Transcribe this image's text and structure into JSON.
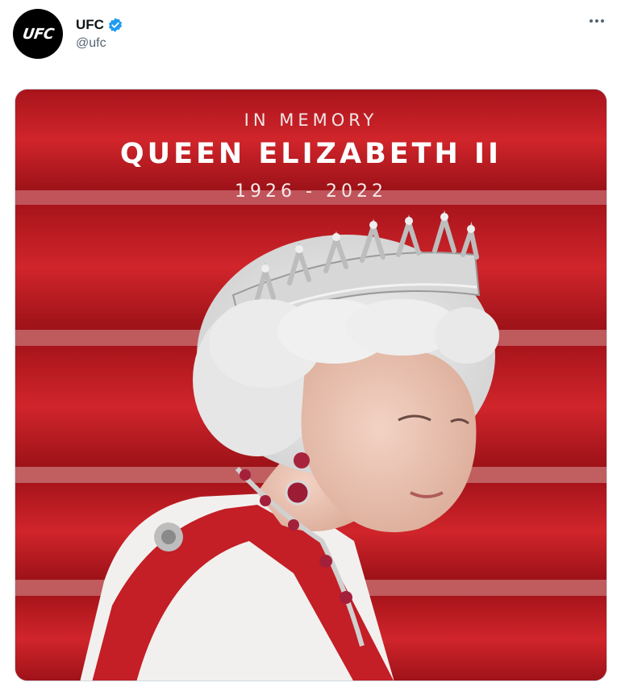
{
  "tweet": {
    "display_name": "UFC",
    "handle": "@ufc",
    "avatar_text": "UFC",
    "verified": true,
    "more_icon": "more-horizontal-icon"
  },
  "media": {
    "line1": "IN MEMORY",
    "line2": "QUEEN ELIZABETH II",
    "line3": "1926 - 2022",
    "background_color": "#b91c22",
    "description_icon": "portrait-photo"
  },
  "colors": {
    "verified_blue": "#1d9bf0",
    "text_primary": "#0f1419",
    "text_secondary": "#536471"
  }
}
